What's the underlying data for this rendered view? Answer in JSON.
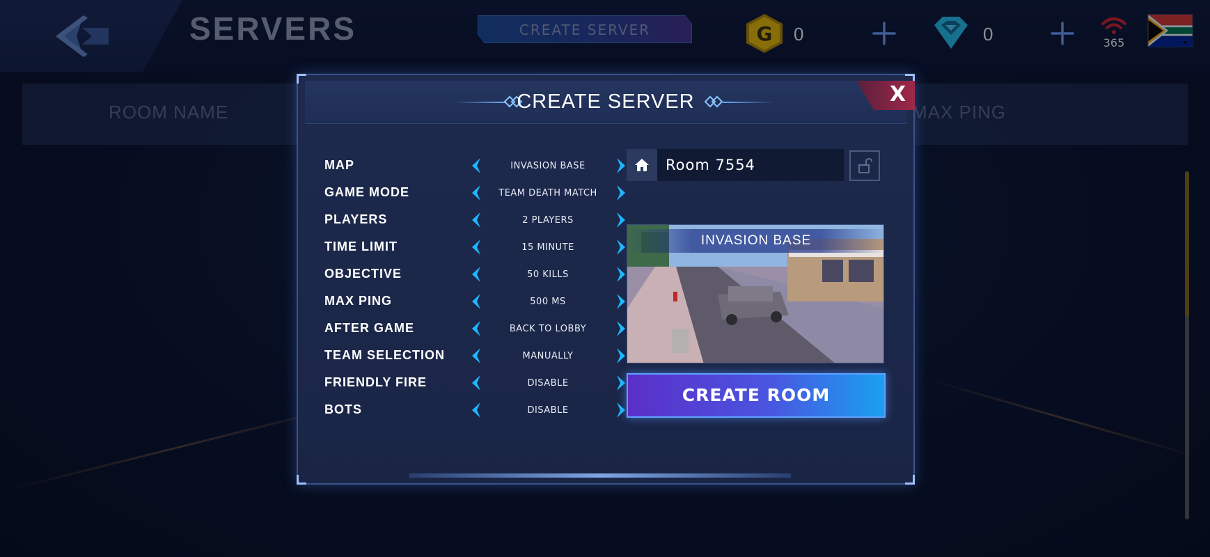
{
  "top_bar": {
    "title": "SERVERS",
    "create_server_button": "CREATE SERVER",
    "gold": {
      "icon": "gold-coin-icon",
      "letter": "G",
      "value": "0"
    },
    "diamonds": {
      "icon": "diamond-icon",
      "value": "0"
    },
    "ping": {
      "icon": "wifi-signal-icon",
      "value": "365"
    },
    "flag": "south-africa-flag-icon"
  },
  "list_header": {
    "columns": [
      "ROOM NAME",
      "MAX PING"
    ]
  },
  "modal": {
    "title": "CREATE SERVER",
    "close_label": "X",
    "settings": [
      {
        "label": "MAP",
        "value": "INVASION BASE"
      },
      {
        "label": "GAME MODE",
        "value": "TEAM DEATH MATCH"
      },
      {
        "label": "PLAYERS",
        "value": "2 PLAYERS"
      },
      {
        "label": "TIME LIMIT",
        "value": "15 MINUTE"
      },
      {
        "label": "OBJECTIVE",
        "value": "50 KILLS"
      },
      {
        "label": "MAX PING",
        "value": "500 MS"
      },
      {
        "label": "AFTER GAME",
        "value": "BACK TO LOBBY"
      },
      {
        "label": "TEAM SELECTION",
        "value": "MANUALLY"
      },
      {
        "label": "FRIENDLY FIRE",
        "value": "DISABLE"
      },
      {
        "label": "BOTS",
        "value": "DISABLE"
      }
    ],
    "room_name": "Room 7554",
    "map_preview_name": "INVASION BASE",
    "create_room_button": "CREATE ROOM"
  },
  "colors": {
    "accent_cyan": "#1fb7ff",
    "gold": "#f2c200",
    "diamond": "#27c6f2",
    "ping_red": "#e0202a",
    "close_red": "#a0284a"
  }
}
